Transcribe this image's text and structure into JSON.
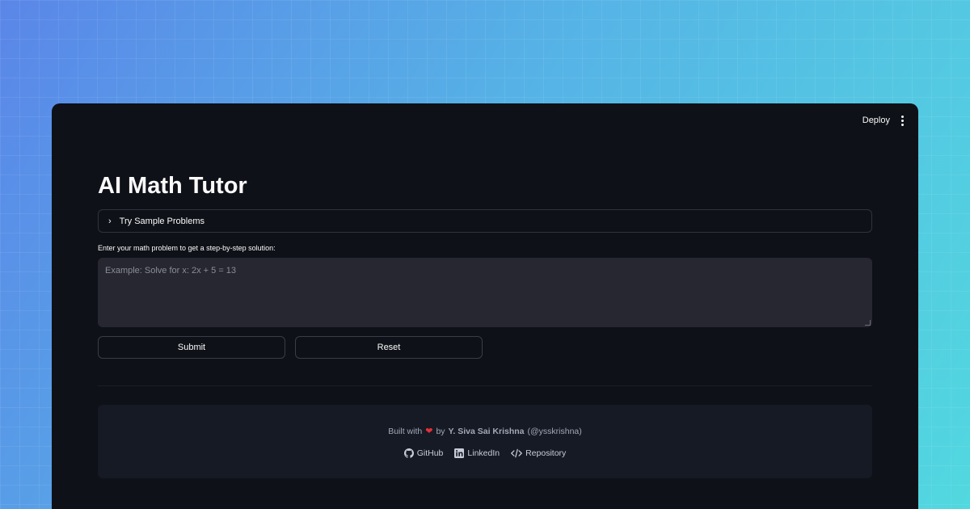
{
  "topbar": {
    "deploy_label": "Deploy",
    "menu_icon": "kebab-menu-icon"
  },
  "main": {
    "title": "AI Math Tutor",
    "expander_label": "Try Sample Problems",
    "expander_icon": "chevron-right-icon",
    "input_label": "Enter your math problem to get a step-by-step solution:",
    "input_placeholder": "Example: Solve for x: 2x + 5 = 13",
    "input_value": "",
    "submit_label": "Submit",
    "reset_label": "Reset"
  },
  "footer": {
    "built_with": "Built with",
    "heart_icon": "heart-icon",
    "by": "by",
    "author": "Y. Siva Sai Krishna",
    "handle": "(@ysskrishna)",
    "links": [
      {
        "label": "GitHub",
        "icon": "github-icon"
      },
      {
        "label": "LinkedIn",
        "icon": "linkedin-icon"
      },
      {
        "label": "Repository",
        "icon": "code-icon"
      }
    ]
  },
  "colors": {
    "app_background": "#0e1117",
    "textarea_background": "#262730",
    "footer_background": "#161a24",
    "heart": "#e5303a"
  }
}
